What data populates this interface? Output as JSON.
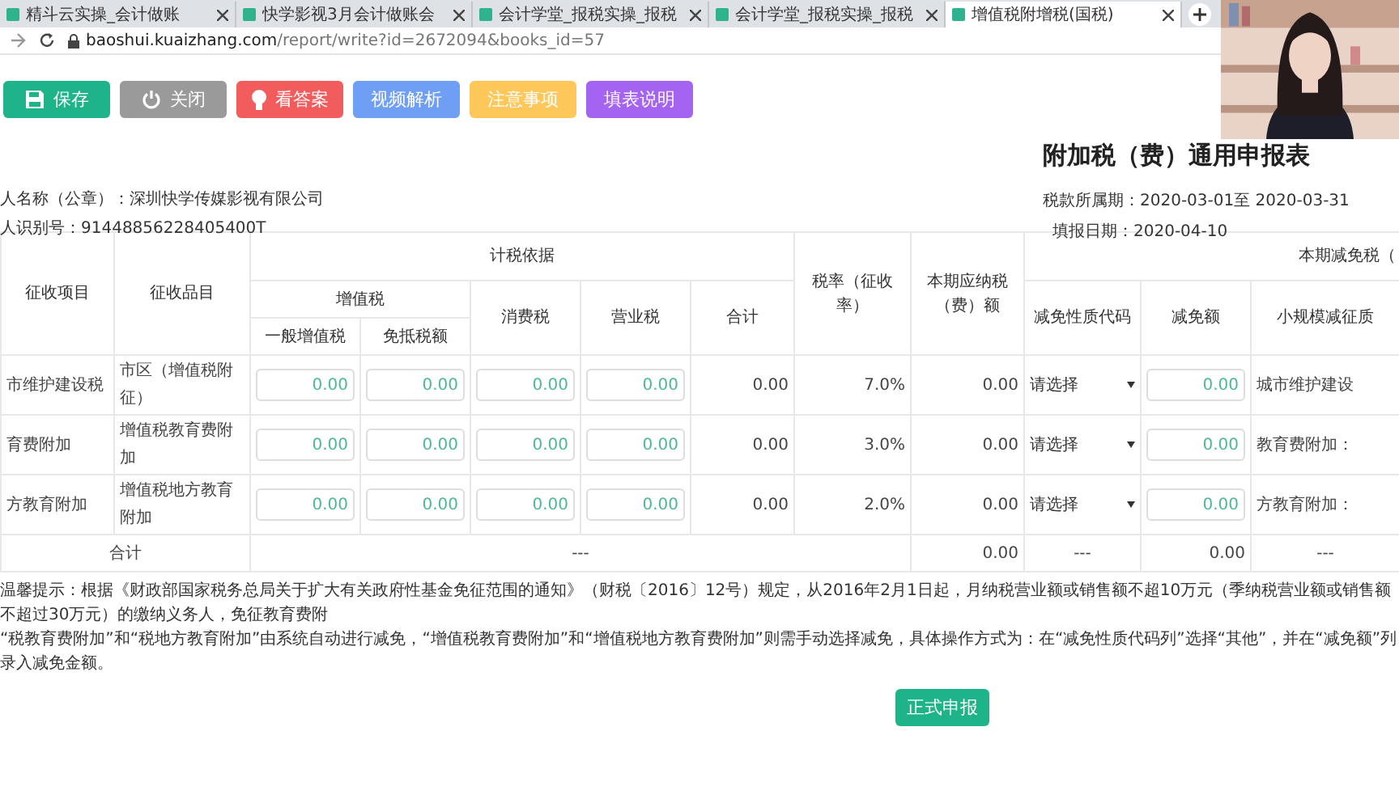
{
  "browser": {
    "tabs": [
      {
        "title": "精斗云实操_会计做账",
        "selected": false
      },
      {
        "title": "快学影视3月会计做账会",
        "selected": false
      },
      {
        "title": "会计学堂_报税实操_报税",
        "selected": false
      },
      {
        "title": "会计学堂_报税实操_报税",
        "selected": false
      },
      {
        "title": "增值税附增税(国税)",
        "selected": true
      }
    ],
    "url_host": "baoshui.kuaizhang.com",
    "url_path": "/report/write?id=2672094&books_id=57"
  },
  "toolbar": [
    {
      "label": "保存",
      "kind": "save",
      "color": "#1fb38a"
    },
    {
      "label": "关闭",
      "kind": "power",
      "color": "#9a9a9a"
    },
    {
      "label": "看答案",
      "kind": "bulb",
      "color": "#f25c5c"
    },
    {
      "label": "视频解析",
      "kind": "plain",
      "color": "#6f9ef5"
    },
    {
      "label": "注意事项",
      "kind": "plain",
      "color": "#fdc75a"
    },
    {
      "label": "填表说明",
      "kind": "plain",
      "color": "#a563f2"
    }
  ],
  "form": {
    "title": "附加税（费）通用申报表",
    "taxpayer_name": "人名称（公章）：深圳快学传媒影视有限公司",
    "taxpayer_id": "人识别号：91448856228405400T",
    "period": "税款所属期：2020-03-01至 2020-03-31",
    "filing_date": "填报日期：2020-04-10"
  },
  "table": {
    "headers": {
      "item": "征收项目",
      "category": "征收品目",
      "basis": "计税依据",
      "vat": "增值税",
      "general_vat": "一般增值税",
      "exempt_vat": "免抵税额",
      "consumption": "消费税",
      "business": "营业税",
      "total": "合计",
      "rate": "税率（征收率）",
      "payable": "本期应纳税（费）额",
      "relief": "本期减免税（",
      "relief_code": "减免性质代码",
      "relief_amount": "减免额",
      "column_12": "小规模减征质"
    },
    "rows": [
      {
        "item": "市维护建设税",
        "category": "市区（增值税附征）",
        "general_vat": "0.00",
        "exempt_vat": "0.00",
        "consumption": "0.00",
        "business": "0.00",
        "total": "0.00",
        "rate": "7.0%",
        "payable": "0.00",
        "relief_code": "请选择",
        "relief_amount": "0.00",
        "column_12": "城市维护建设"
      },
      {
        "item": "育费附加",
        "category": "增值税教育费附加",
        "general_vat": "0.00",
        "exempt_vat": "0.00",
        "consumption": "0.00",
        "business": "0.00",
        "total": "0.00",
        "rate": "3.0%",
        "payable": "0.00",
        "relief_code": "请选择",
        "relief_amount": "0.00",
        "column_12": "教育费附加："
      },
      {
        "item": "方教育附加",
        "category": "增值税地方教育附加",
        "general_vat": "0.00",
        "exempt_vat": "0.00",
        "consumption": "0.00",
        "business": "0.00",
        "total": "0.00",
        "rate": "2.0%",
        "payable": "0.00",
        "relief_code": "请选择",
        "relief_amount": "0.00",
        "column_12": "方教育附加："
      }
    ],
    "total_row": {
      "label": "合计",
      "basis": "---",
      "payable": "0.00",
      "relief_code": "---",
      "relief_amount": "0.00",
      "column_12": "---"
    }
  },
  "notice": [
    "温馨提示：根据《财政部国家税务总局关于扩大有关政府性基金免征范围的通知》（财税〔2016〕12号）规定，从2016年2月1日起，月纳税营业额或销售额不超10万元（季纳税营业额或销售额不超过30万元）的缴纳义务人，免征教育费附",
    "“税教育费附加”和“税地方教育附加”由系统自动进行减免，“增值税教育费附加”和“增值税地方教育费附加”则需手动选择减免，具体操作方式为：在“减免性质代码列”选择“其他”，并在“减免额”列录入减免金额。"
  ],
  "submit_button": "正式申报",
  "webcam": {
    "kind": "picture"
  }
}
